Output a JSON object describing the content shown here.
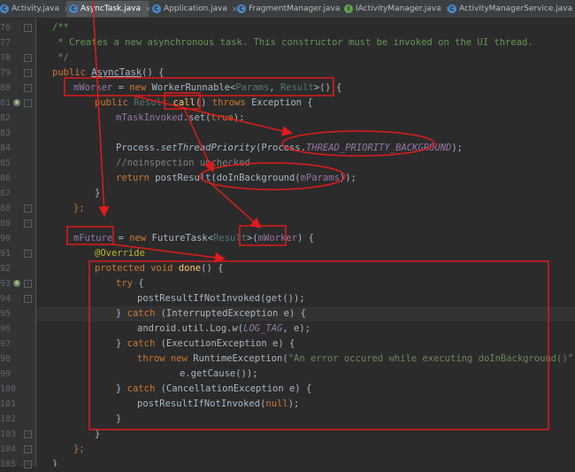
{
  "tabs": [
    {
      "label": "Activity.java",
      "icon": "class-icon",
      "color": "#4a87c7",
      "active": false
    },
    {
      "label": "AsyncTask.java",
      "icon": "class-icon",
      "color": "#4a87c7",
      "active": true
    },
    {
      "label": "Application.java",
      "icon": "class-icon",
      "color": "#4a87c7",
      "active": false
    },
    {
      "label": "FragmentManager.java",
      "icon": "class-icon",
      "color": "#4a87c7",
      "active": false
    },
    {
      "label": "IActivityManager.java",
      "icon": "interface-icon",
      "color": "#5fa04e",
      "active": false
    },
    {
      "label": "ActivityManagerService.java",
      "icon": "class-icon",
      "color": "#4a87c7",
      "active": false
    }
  ],
  "gutter": {
    "line_numbers": [
      "76",
      "77",
      "78",
      "79",
      "80",
      "81",
      "82",
      "83",
      "84",
      "85",
      "86",
      "87",
      "88",
      "89",
      "90",
      "91",
      "92",
      "93",
      "94",
      "95",
      "96",
      "97",
      "98",
      "99",
      "100",
      "101",
      "102",
      "103",
      "104",
      "105"
    ]
  },
  "code": {
    "l76_a": "/**",
    "l77_a": " * Creates a new asynchronous task. This constructor must be invoked on the UI thread.",
    "l78_a": " */",
    "l79_kw": "public ",
    "l79_b": "AsyncTask",
    "l79_c": "() {",
    "l80_f": "mWorker",
    "l80_b": " = ",
    "l80_kw": "new ",
    "l80_c": "WorkerRunnable<",
    "l80_g1": "Params",
    "l80_d": ", ",
    "l80_g2": "Result",
    "l80_e": ">() {",
    "l81_kw1": "public ",
    "l81_g": "Result ",
    "l81_b": "call",
    "l81_c": "() ",
    "l81_kw2": "throws ",
    "l81_d": "Exception {",
    "l82_f": "mTaskInvoked",
    "l82_b": ".set(",
    "l82_kw": "true",
    "l82_c": ");",
    "l84_a": "Process.",
    "l84_b": "setThreadPriority",
    "l84_c": "(Process.",
    "l84_f": "THREAD_PRIORITY_BACKGROUND",
    "l84_d": ");",
    "l85_a": "//noinspection unchecked",
    "l86_kw": "return ",
    "l86_a": "postResult(doInBackground(",
    "l86_f": "mParams",
    "l86_b": "));",
    "l87_a": "}",
    "l88_a": "};",
    "l90_f": "mFuture",
    "l90_b": " = ",
    "l90_kw": "new ",
    "l90_c": "FutureTask<",
    "l90_g": "Result",
    "l90_d": ">(",
    "l90_f2": "mWorker",
    "l90_e": ") {",
    "l91_a": "@Override",
    "l92_kw": "protected void ",
    "l92_b": "done",
    "l92_c": "() {",
    "l93_kw": "try ",
    "l93_a": "{",
    "l94_a": "postResultIfNotInvoked(get());",
    "l95_a": "} ",
    "l95_kw": "catch ",
    "l95_b": "(InterruptedException e) {",
    "l96_a": "android.util.Log.",
    "l96_b": "w",
    "l96_c": "(",
    "l96_f": "LOG_TAG",
    "l96_d": ", e);",
    "l97_a": "} ",
    "l97_kw": "catch ",
    "l97_b": "(ExecutionException e) {",
    "l98_kw": "throw new ",
    "l98_a": "RuntimeException(",
    "l98_s": "\"An error occured while executing doInBackground()\"",
    "l98_b": ",",
    "l99_a": "e.getCause());",
    "l100_a": "} ",
    "l100_kw": "catch ",
    "l100_b": "(CancellationException e) {",
    "l101_a": "postResultIfNotInvoked(",
    "l101_kw": "null",
    "l101_b": ");",
    "l102_a": "}",
    "l103_a": "}",
    "l104_a": "};",
    "l105_a": "}"
  },
  "annotation_color": "#e01b1b"
}
